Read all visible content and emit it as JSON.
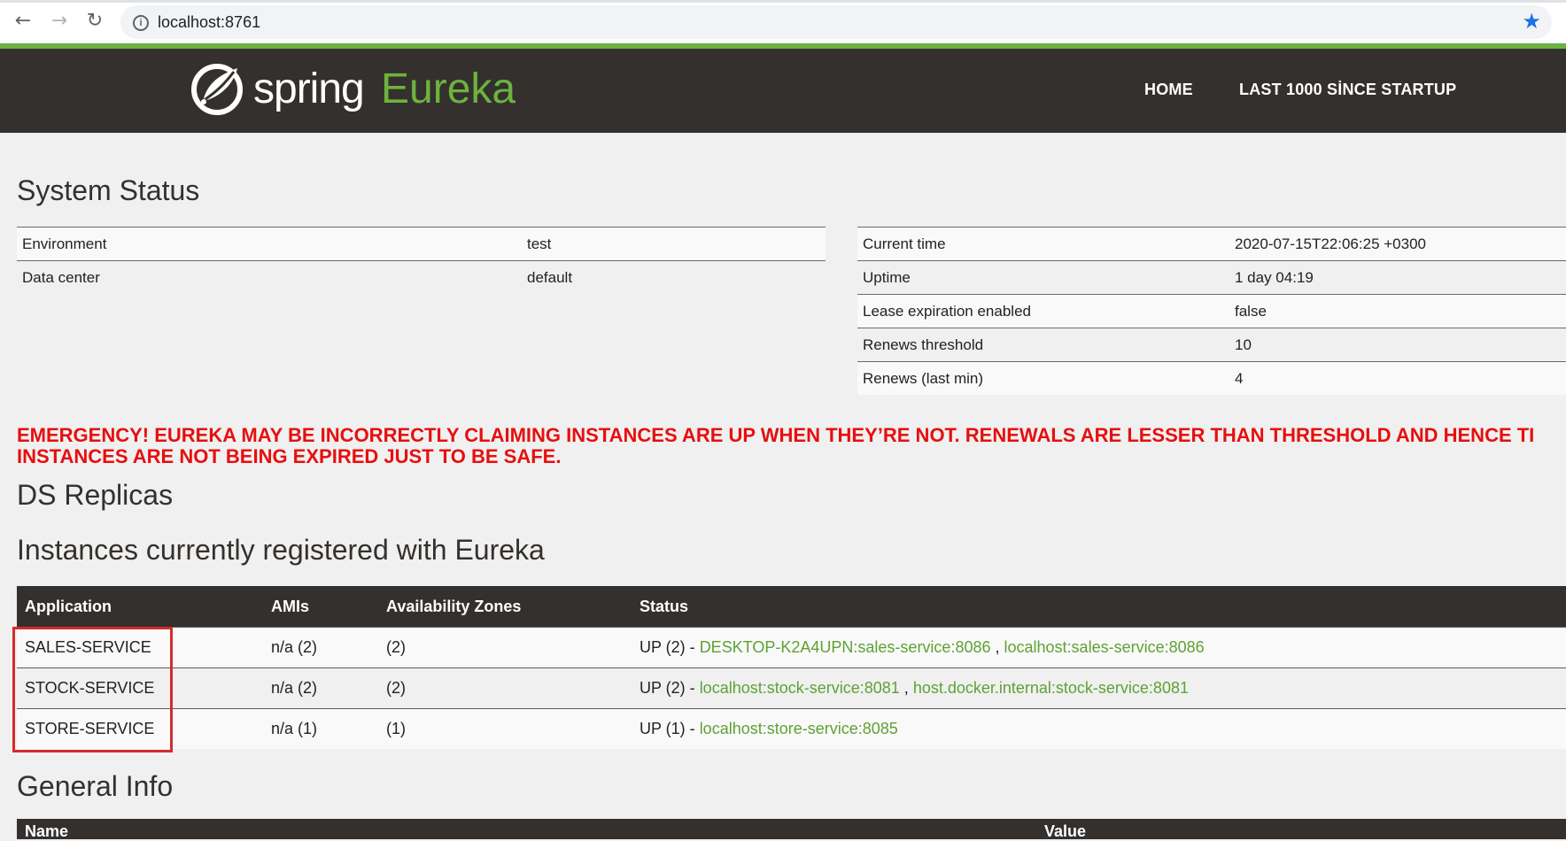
{
  "browser": {
    "url": "localhost:8761",
    "back_icon": "←",
    "forward_icon": "→",
    "reload_icon": "↻",
    "info_icon": "i",
    "star_icon": "★"
  },
  "header": {
    "logo_word1": "spring",
    "logo_word2": "Eureka",
    "nav": [
      "HOME",
      "LAST 1000 SİNCE STARTUP"
    ]
  },
  "system_status": {
    "title": "System Status",
    "left": [
      {
        "label": "Environment",
        "value": "test"
      },
      {
        "label": "Data center",
        "value": "default"
      }
    ],
    "right": [
      {
        "label": "Current time",
        "value": "2020-07-15T22:06:25 +0300"
      },
      {
        "label": "Uptime",
        "value": "1 day 04:19"
      },
      {
        "label": "Lease expiration enabled",
        "value": "false"
      },
      {
        "label": "Renews threshold",
        "value": "10"
      },
      {
        "label": "Renews (last min)",
        "value": "4"
      }
    ]
  },
  "emergency": {
    "line1": "EMERGENCY! EUREKA MAY BE INCORRECTLY CLAIMING INSTANCES ARE UP WHEN THEY’RE NOT. RENEWALS ARE LESSER THAN THRESHOLD AND HENCE TI",
    "line2": "INSTANCES ARE NOT BEING EXPIRED JUST TO BE SAFE."
  },
  "ds_replicas_title": "DS Replicas",
  "instances": {
    "title": "Instances currently registered with Eureka",
    "columns": [
      "Application",
      "AMIs",
      "Availability Zones",
      "Status"
    ],
    "rows": [
      {
        "app": "SALES-SERVICE",
        "amis": "n/a (2)",
        "zones": "(2)",
        "status": "UP (2) - ",
        "links": [
          "DESKTOP-K2A4UPN:sales-service:8086",
          "localhost:sales-service:8086"
        ]
      },
      {
        "app": "STOCK-SERVICE",
        "amis": "n/a (2)",
        "zones": "(2)",
        "status": "UP (2) - ",
        "links": [
          "localhost:stock-service:8081",
          "host.docker.internal:stock-service:8081"
        ]
      },
      {
        "app": "STORE-SERVICE",
        "amis": "n/a (1)",
        "zones": "(1)",
        "status": "UP (1) - ",
        "links": [
          "localhost:store-service:8085"
        ]
      }
    ]
  },
  "general_info": {
    "title": "General Info",
    "columns": [
      "Name",
      "Value"
    ]
  }
}
